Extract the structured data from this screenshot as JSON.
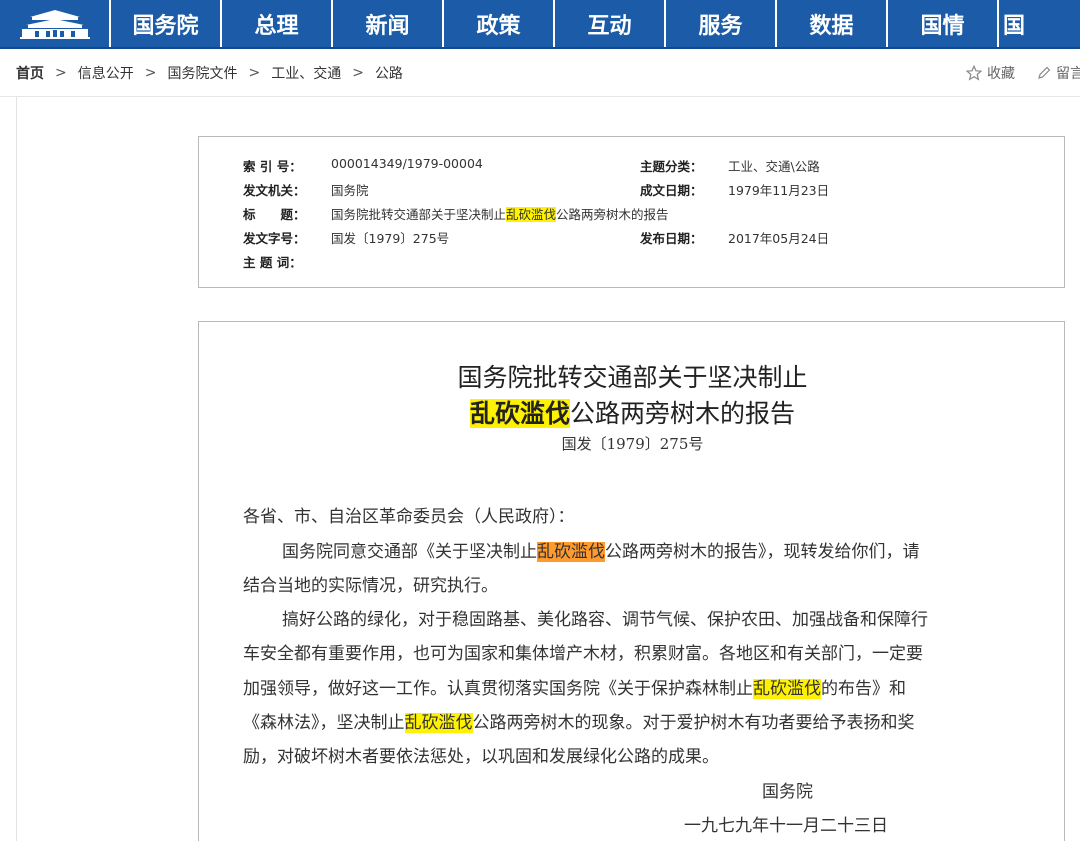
{
  "nav": {
    "items": [
      "国务院",
      "总理",
      "新闻",
      "政策",
      "互动",
      "服务",
      "数据",
      "国情",
      "国"
    ]
  },
  "breadcrumb": {
    "items": [
      "首页",
      "信息公开",
      "国务院文件",
      "工业、交通",
      "公路"
    ],
    "separator": ">"
  },
  "tools": {
    "favorite": "收藏",
    "comment": "留言"
  },
  "meta": {
    "index_label": "索 引 号：",
    "index_value": "000014349/1979-00004",
    "topic_label": "主题分类：",
    "topic_value": "工业、交通\\公路",
    "issuer_label": "发文机关：",
    "issuer_value": "国务院",
    "date_written_label": "成文日期：",
    "date_written_value": "1979年11月23日",
    "title_label": "标　　题：",
    "title_pre": "国务院批转交通部关于坚决制止",
    "title_hl": "乱砍滥伐",
    "title_post": "公路两旁树木的报告",
    "docno_label": "发文字号：",
    "docno_value": "国发〔1979〕275号",
    "publish_label": "发布日期：",
    "publish_value": "2017年05月24日",
    "keywords_label": "主 题 词："
  },
  "article": {
    "title_line1": "国务院批转交通部关于坚决制止",
    "title_line2_hl": "乱砍滥伐",
    "title_line2_rest": "公路两旁树木的报告",
    "docno": "国发〔1979〕275号",
    "salutation": "各省、市、自治区革命委员会（人民政府）：",
    "p1_l1_pre": "国务院同意交通部《关于坚决制止",
    "p1_l1_hl": "乱砍滥伐",
    "p1_l1_post": "公路两旁树木的报告》，现转发给你们，请",
    "p1_l2": "结合当地的实际情况，研究执行。",
    "p2_l1": "搞好公路的绿化，对于稳固路基、美化路容、调节气候、保护农田、加强战备和保障行",
    "p2_l2": "车安全都有重要作用，也可为国家和集体增产木材，积累财富。各地区和有关部门，一定要",
    "p2_l3_pre": "加强领导，做好这一工作。认真贯彻落实国务院《关于保护森林制止",
    "p2_l3_hl": "乱砍滥伐",
    "p2_l3_post": "的布告》和",
    "p2_l4_pre": "《森林法》，坚决制止",
    "p2_l4_hl": "乱砍滥伐",
    "p2_l4_post": "公路两旁树木的现象。对于爱护树木有功者要给予表扬和奖",
    "p2_l5": "励，对破坏树木者要依法惩处，以巩固和发展绿化公路的成果。",
    "signature": "国务院",
    "sign_date": "一九七九年十一月二十三日"
  },
  "colors": {
    "nav_bg": "#1b5ba8",
    "highlight_yellow": "#fff200",
    "highlight_orange": "#ff9a2e"
  },
  "icons": {
    "logo": "tiananmen-gate-logo",
    "favorite": "star-icon",
    "comment": "pencil-icon"
  }
}
